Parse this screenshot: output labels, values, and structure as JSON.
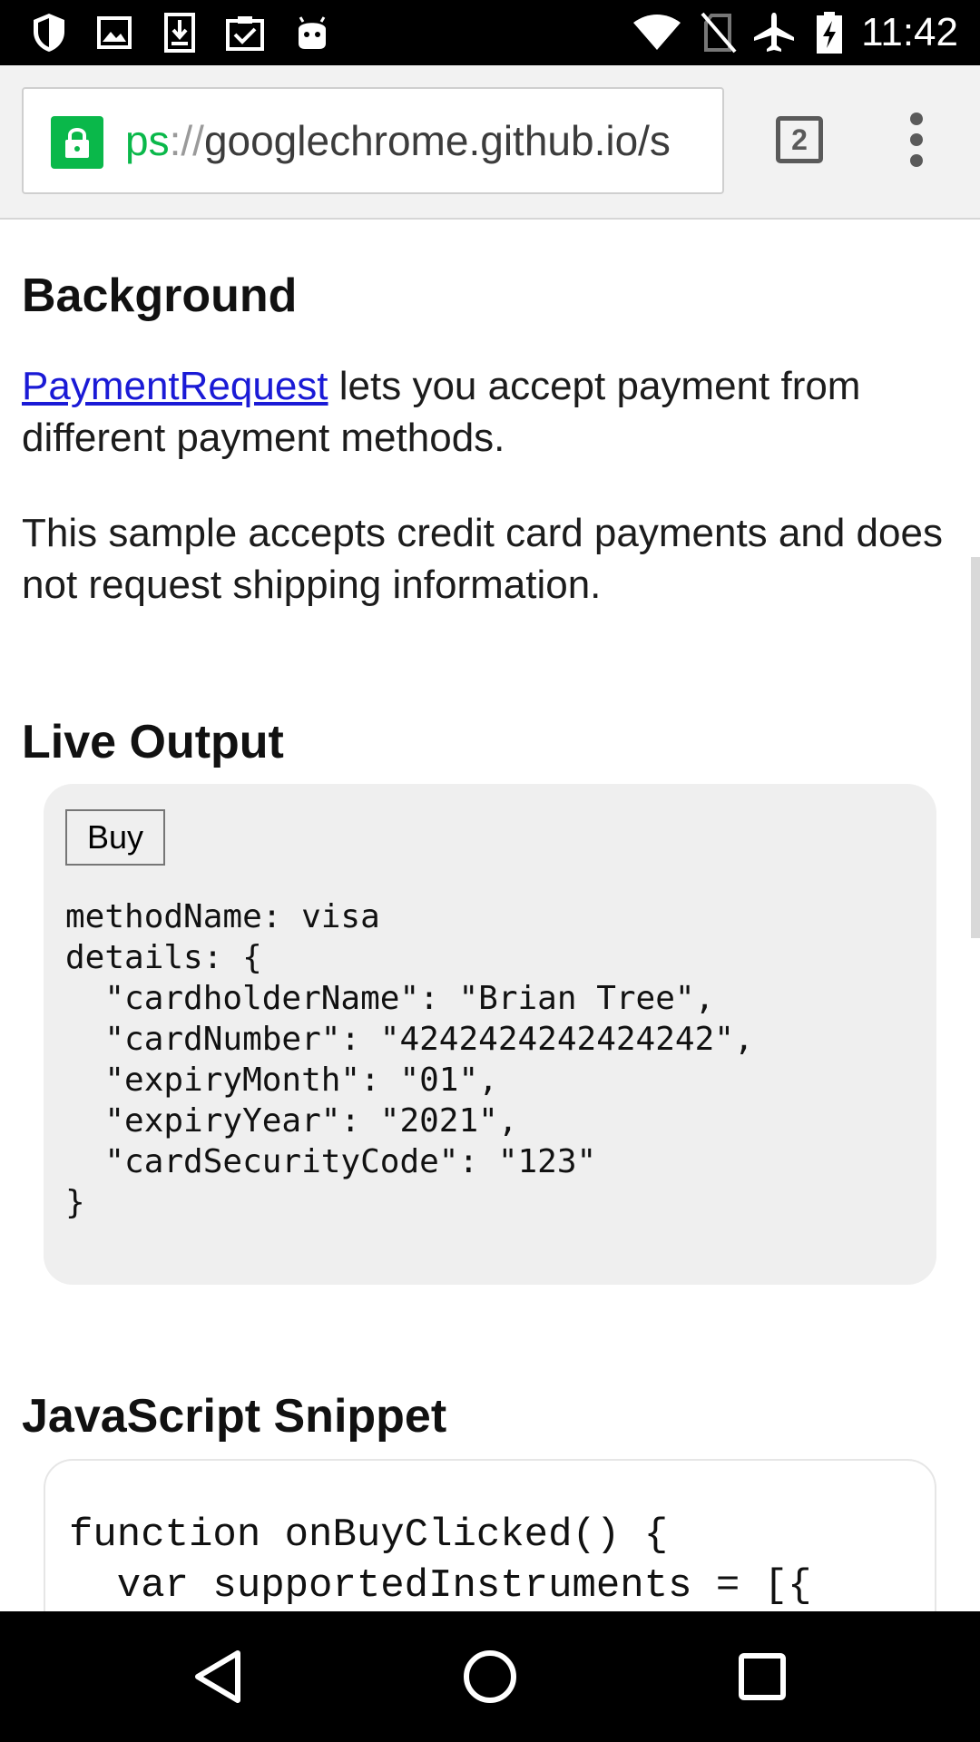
{
  "status_bar": {
    "time": "11:42",
    "left_icons": [
      "shield-icon",
      "image-icon",
      "download-icon",
      "clipboard-check-icon",
      "android-icon"
    ],
    "right_icons": [
      "wifi-icon",
      "no-sim-icon",
      "airplane-icon",
      "battery-charging-icon"
    ]
  },
  "browser": {
    "url_scheme": "ps",
    "url_sep": "://",
    "url_host": "googlechrome.github.io/s",
    "tab_count": "2",
    "accent_color": "#0ab84a"
  },
  "page": {
    "background_heading": "Background",
    "intro_link": "PaymentRequest",
    "intro_rest": " lets you accept payment from different payment methods.",
    "sample_text": "This sample accepts credit card payments and does not request shipping information.",
    "live_output_heading": "Live Output",
    "buy_label": "Buy",
    "output_text": "methodName: visa\ndetails: {\n  \"cardholderName\": \"Brian Tree\",\n  \"cardNumber\": \"4242424242424242\",\n  \"expiryMonth\": \"01\",\n  \"expiryYear\": \"2021\",\n  \"cardSecurityCode\": \"123\"\n}",
    "snippet_heading": "JavaScript Snippet",
    "snippet_code": "function onBuyClicked() {\n  var supportedInstruments = [{"
  },
  "nav_bar": {
    "buttons": [
      "back-icon",
      "home-icon",
      "recents-icon"
    ]
  }
}
